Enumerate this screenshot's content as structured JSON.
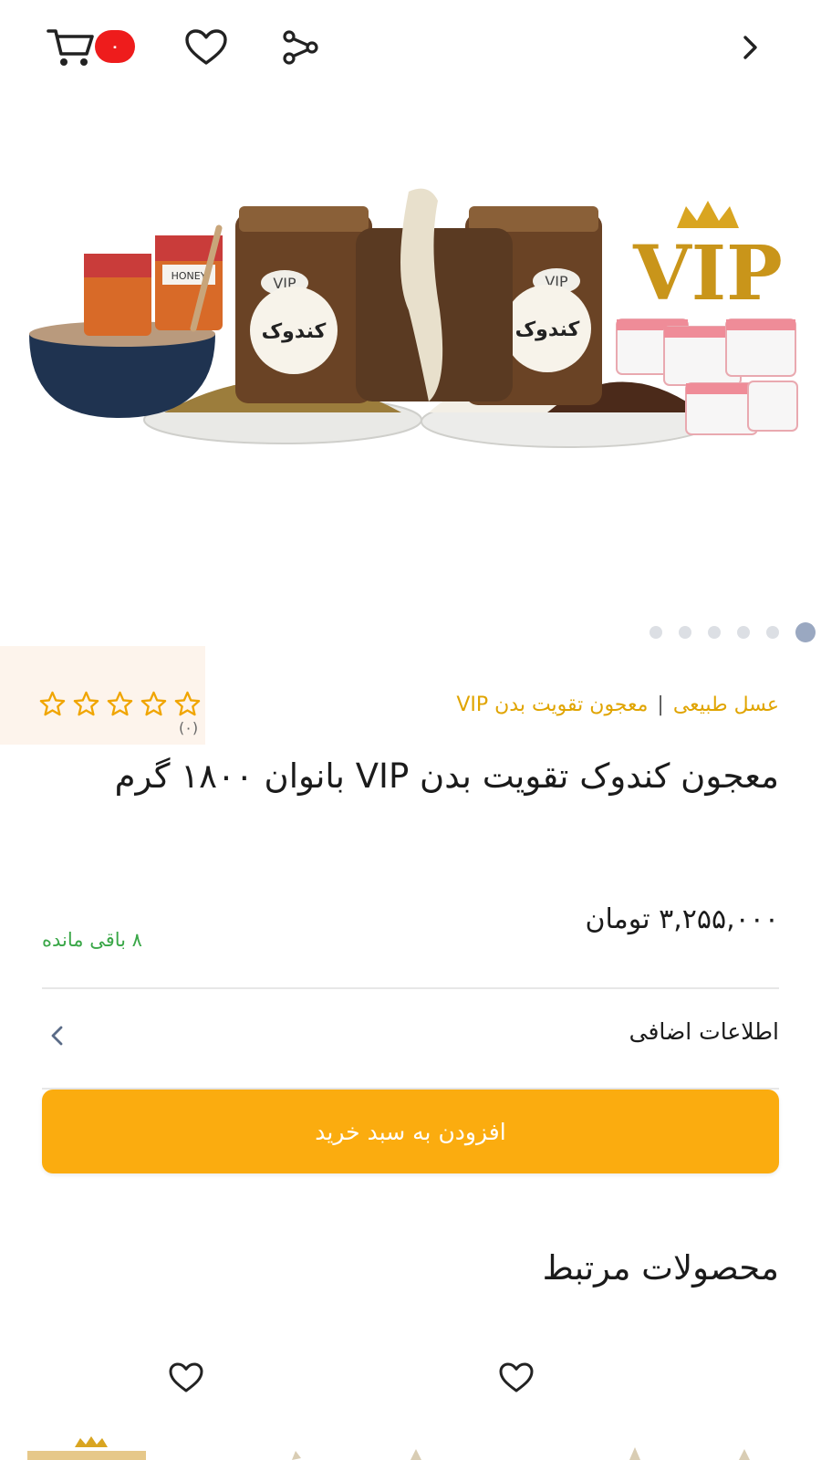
{
  "header": {
    "back_icon": "chevron-right-icon",
    "share_icon": "share-icon",
    "wishlist_icon": "heart-icon",
    "cart_icon": "cart-icon",
    "cart_count": "۰"
  },
  "gallery": {
    "slide_count": 6,
    "active_index": 0,
    "product_visible_text": {
      "vip_logo": "VIP",
      "jar_label": "VIP",
      "jar_brand": "کندوک",
      "honey_label": "HONEY"
    }
  },
  "product": {
    "category_primary": "عسل طبیعی",
    "category_separator": "|",
    "category_secondary": "معجون تقویت بدن VIP",
    "rating": {
      "stars_filled": 0,
      "stars_total": 5,
      "count_label": "(۰)"
    },
    "title": "معجون کندوک تقویت بدن VIP بانوان ۱۸۰۰ گرم",
    "price": "۳,۲۵۵,۰۰۰ تومان",
    "stock": "۸ باقی مانده",
    "extra_info_label": "اطلاعات اضافی",
    "add_to_cart_label": "افزودن به سبد خرید"
  },
  "related": {
    "title": "محصولات مرتبط"
  },
  "colors": {
    "accent": "#fbac0f",
    "category": "#e0a400",
    "stock": "#3aa748",
    "badge": "#ee1c1c",
    "dot_active": "#9aa8c1"
  }
}
